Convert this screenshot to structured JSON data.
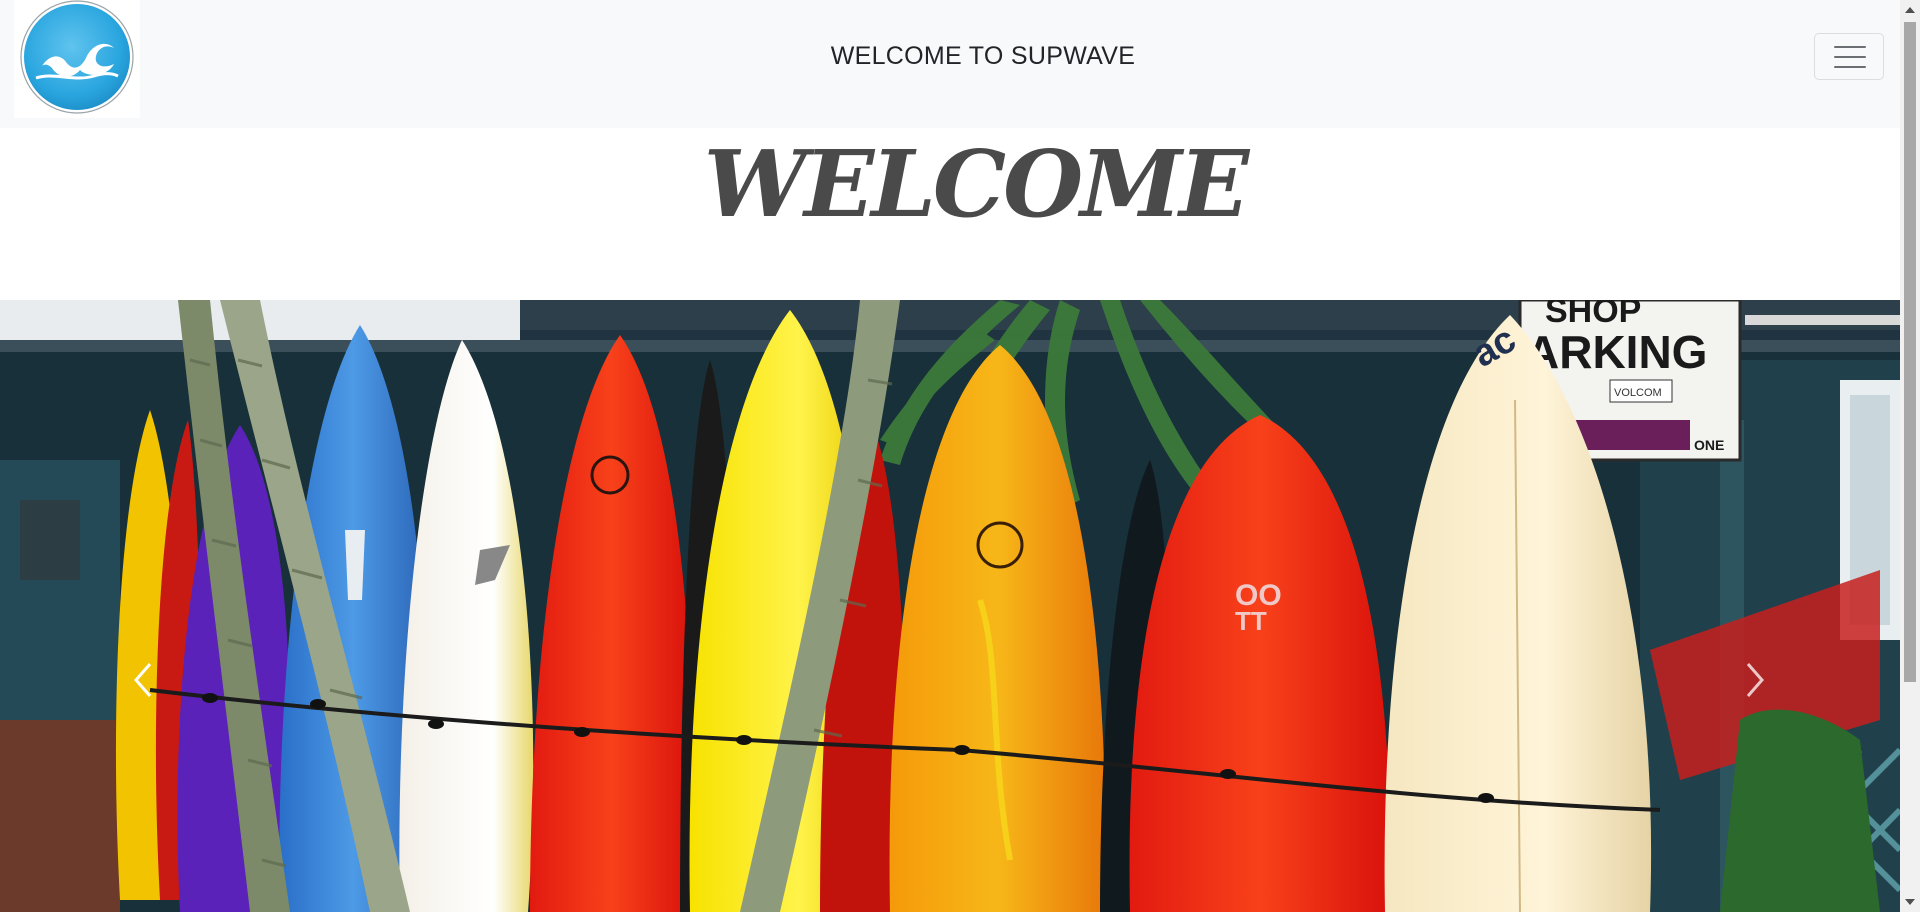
{
  "navbar": {
    "brand_logo": "wave-logo-icon",
    "title": "WELCOME TO SUPWAVE",
    "toggler_icon": "hamburger-menu-icon"
  },
  "hero": {
    "heading": "WELCOME"
  },
  "carousel": {
    "image_subject": "surfboards-photo",
    "prev_icon": "chevron-left-icon",
    "next_icon": "chevron-right-icon",
    "sign_text_top": "SHOP",
    "sign_text_main": "PARKING",
    "sign_text_brand": "VOLCOM",
    "sign_text_one": "ONE",
    "board_logo": "ac"
  },
  "colors": {
    "navbar_bg": "#f8f9fa",
    "logo_blue": "#2aa6df",
    "heading_gray": "#4a4a4a"
  }
}
